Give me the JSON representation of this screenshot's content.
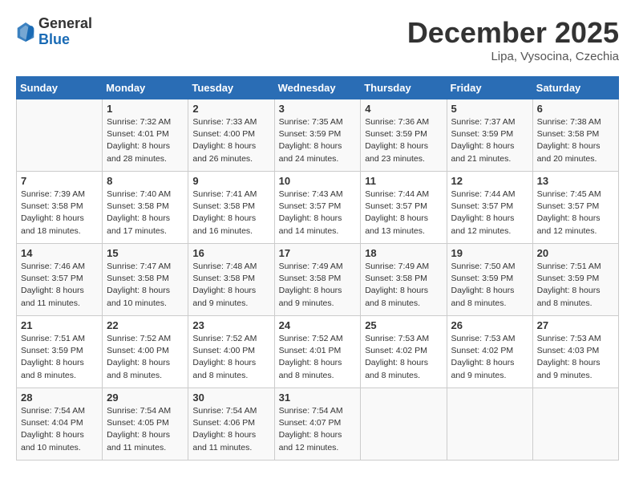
{
  "header": {
    "logo_general": "General",
    "logo_blue": "Blue",
    "month": "December 2025",
    "location": "Lipa, Vysocina, Czechia"
  },
  "weekdays": [
    "Sunday",
    "Monday",
    "Tuesday",
    "Wednesday",
    "Thursday",
    "Friday",
    "Saturday"
  ],
  "weeks": [
    [
      {
        "day": "",
        "sunrise": "",
        "sunset": "",
        "daylight": ""
      },
      {
        "day": "1",
        "sunrise": "7:32 AM",
        "sunset": "4:01 PM",
        "daylight": "8 hours and 28 minutes."
      },
      {
        "day": "2",
        "sunrise": "7:33 AM",
        "sunset": "4:00 PM",
        "daylight": "8 hours and 26 minutes."
      },
      {
        "day": "3",
        "sunrise": "7:35 AM",
        "sunset": "3:59 PM",
        "daylight": "8 hours and 24 minutes."
      },
      {
        "day": "4",
        "sunrise": "7:36 AM",
        "sunset": "3:59 PM",
        "daylight": "8 hours and 23 minutes."
      },
      {
        "day": "5",
        "sunrise": "7:37 AM",
        "sunset": "3:59 PM",
        "daylight": "8 hours and 21 minutes."
      },
      {
        "day": "6",
        "sunrise": "7:38 AM",
        "sunset": "3:58 PM",
        "daylight": "8 hours and 20 minutes."
      }
    ],
    [
      {
        "day": "7",
        "sunrise": "7:39 AM",
        "sunset": "3:58 PM",
        "daylight": "8 hours and 18 minutes."
      },
      {
        "day": "8",
        "sunrise": "7:40 AM",
        "sunset": "3:58 PM",
        "daylight": "8 hours and 17 minutes."
      },
      {
        "day": "9",
        "sunrise": "7:41 AM",
        "sunset": "3:58 PM",
        "daylight": "8 hours and 16 minutes."
      },
      {
        "day": "10",
        "sunrise": "7:43 AM",
        "sunset": "3:57 PM",
        "daylight": "8 hours and 14 minutes."
      },
      {
        "day": "11",
        "sunrise": "7:44 AM",
        "sunset": "3:57 PM",
        "daylight": "8 hours and 13 minutes."
      },
      {
        "day": "12",
        "sunrise": "7:44 AM",
        "sunset": "3:57 PM",
        "daylight": "8 hours and 12 minutes."
      },
      {
        "day": "13",
        "sunrise": "7:45 AM",
        "sunset": "3:57 PM",
        "daylight": "8 hours and 12 minutes."
      }
    ],
    [
      {
        "day": "14",
        "sunrise": "7:46 AM",
        "sunset": "3:57 PM",
        "daylight": "8 hours and 11 minutes."
      },
      {
        "day": "15",
        "sunrise": "7:47 AM",
        "sunset": "3:58 PM",
        "daylight": "8 hours and 10 minutes."
      },
      {
        "day": "16",
        "sunrise": "7:48 AM",
        "sunset": "3:58 PM",
        "daylight": "8 hours and 9 minutes."
      },
      {
        "day": "17",
        "sunrise": "7:49 AM",
        "sunset": "3:58 PM",
        "daylight": "8 hours and 9 minutes."
      },
      {
        "day": "18",
        "sunrise": "7:49 AM",
        "sunset": "3:58 PM",
        "daylight": "8 hours and 8 minutes."
      },
      {
        "day": "19",
        "sunrise": "7:50 AM",
        "sunset": "3:59 PM",
        "daylight": "8 hours and 8 minutes."
      },
      {
        "day": "20",
        "sunrise": "7:51 AM",
        "sunset": "3:59 PM",
        "daylight": "8 hours and 8 minutes."
      }
    ],
    [
      {
        "day": "21",
        "sunrise": "7:51 AM",
        "sunset": "3:59 PM",
        "daylight": "8 hours and 8 minutes."
      },
      {
        "day": "22",
        "sunrise": "7:52 AM",
        "sunset": "4:00 PM",
        "daylight": "8 hours and 8 minutes."
      },
      {
        "day": "23",
        "sunrise": "7:52 AM",
        "sunset": "4:00 PM",
        "daylight": "8 hours and 8 minutes."
      },
      {
        "day": "24",
        "sunrise": "7:52 AM",
        "sunset": "4:01 PM",
        "daylight": "8 hours and 8 minutes."
      },
      {
        "day": "25",
        "sunrise": "7:53 AM",
        "sunset": "4:02 PM",
        "daylight": "8 hours and 8 minutes."
      },
      {
        "day": "26",
        "sunrise": "7:53 AM",
        "sunset": "4:02 PM",
        "daylight": "8 hours and 9 minutes."
      },
      {
        "day": "27",
        "sunrise": "7:53 AM",
        "sunset": "4:03 PM",
        "daylight": "8 hours and 9 minutes."
      }
    ],
    [
      {
        "day": "28",
        "sunrise": "7:54 AM",
        "sunset": "4:04 PM",
        "daylight": "8 hours and 10 minutes."
      },
      {
        "day": "29",
        "sunrise": "7:54 AM",
        "sunset": "4:05 PM",
        "daylight": "8 hours and 11 minutes."
      },
      {
        "day": "30",
        "sunrise": "7:54 AM",
        "sunset": "4:06 PM",
        "daylight": "8 hours and 11 minutes."
      },
      {
        "day": "31",
        "sunrise": "7:54 AM",
        "sunset": "4:07 PM",
        "daylight": "8 hours and 12 minutes."
      },
      {
        "day": "",
        "sunrise": "",
        "sunset": "",
        "daylight": ""
      },
      {
        "day": "",
        "sunrise": "",
        "sunset": "",
        "daylight": ""
      },
      {
        "day": "",
        "sunrise": "",
        "sunset": "",
        "daylight": ""
      }
    ]
  ]
}
